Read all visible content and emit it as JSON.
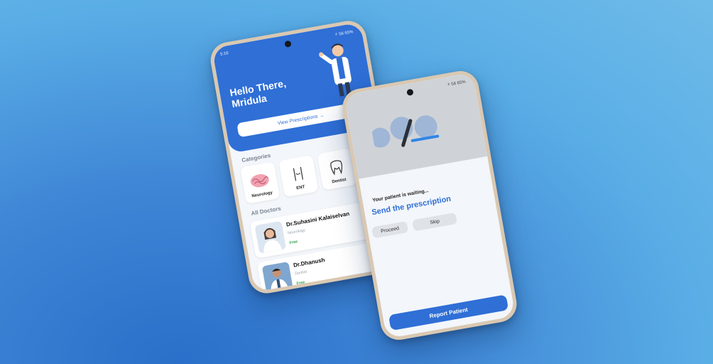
{
  "phone_home": {
    "status_time": "5:16",
    "status_right": "⚡ 56 65%",
    "greeting_line1": "Hello There,",
    "greeting_line2": "Mridula",
    "view_prescriptions": "View Prescriptions →",
    "categories_title": "Categories",
    "categories": [
      {
        "label": "Neurology",
        "icon": "brain-icon"
      },
      {
        "label": "ENT",
        "icon": "throat-icon"
      },
      {
        "label": "Dentist",
        "icon": "tooth-icon"
      }
    ],
    "doctors_title": "All Doctors",
    "doctors": [
      {
        "name": "Dr.Suhasini Kalaiselvan",
        "specialty": "Neurology",
        "price": "Free"
      },
      {
        "name": "Dr.Dhanush",
        "specialty": "Dentist",
        "price": "Free"
      }
    ]
  },
  "phone_session": {
    "status_right": "⚡ 56 65%",
    "waiting_text": "Your patient is waiting...",
    "send_text": "Send the prescription",
    "proceed_label": "Proceed",
    "skip_label": "Skip",
    "report_label": "Report Patient"
  },
  "colors": {
    "primary": "#2f6fd6",
    "background": "#5aaee6",
    "price_green": "#2aa146"
  }
}
